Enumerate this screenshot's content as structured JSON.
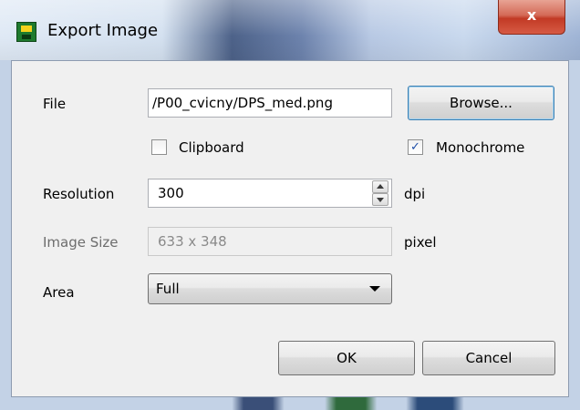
{
  "window": {
    "title": "Export Image",
    "close_label": "x"
  },
  "labels": {
    "file": "File",
    "resolution": "Resolution",
    "image_size": "Image Size",
    "area": "Area",
    "dpi_unit": "dpi",
    "pixel_unit": "pixel"
  },
  "file": {
    "value": "/P00_cvicny/DPS_med.png",
    "browse_label": "Browse..."
  },
  "clipboard": {
    "label": "Clipboard",
    "checked": false
  },
  "monochrome": {
    "label": "Monochrome",
    "checked": true
  },
  "resolution": {
    "value": "300"
  },
  "image_size": {
    "value": "633 x 348"
  },
  "area": {
    "selected": "Full"
  },
  "buttons": {
    "ok": "OK",
    "cancel": "Cancel"
  },
  "icons": {
    "app": "app-icon",
    "close": "close-icon",
    "checkmark": "checkmark-icon",
    "spin_up": "spin-up-icon",
    "spin_down": "spin-down-icon",
    "dropdown": "chevron-down-icon"
  }
}
